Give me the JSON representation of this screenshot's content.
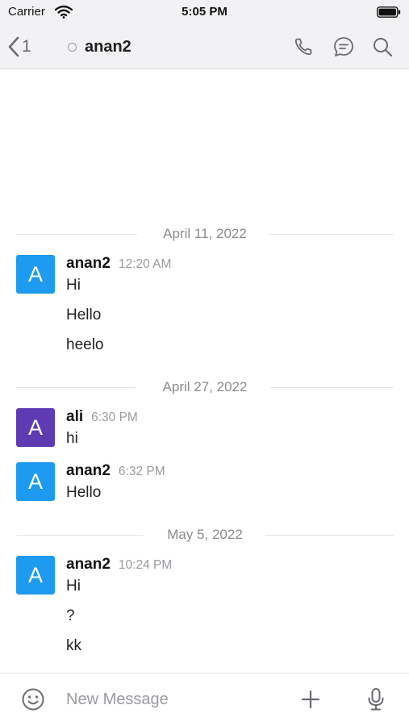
{
  "status_bar": {
    "carrier": "Carrier",
    "time": "5:05 PM"
  },
  "header": {
    "back_count": "1",
    "room_name": "anan2"
  },
  "icons": {
    "wifi": "wifi-icon",
    "battery": "battery-icon",
    "back": "chevron-left-icon",
    "presence": "status-offline-icon",
    "call": "phone-icon",
    "threads": "discussion-icon",
    "search": "search-icon",
    "emoji": "smiley-icon",
    "plus": "plus-icon",
    "mic": "microphone-icon"
  },
  "colors": {
    "avatar_anan2": "#1d9bf0",
    "avatar_ali": "#5f3bb3",
    "divider": "#e3e3e6",
    "muted_text": "#9a9aa0"
  },
  "days": [
    {
      "date": "April 11, 2022"
    },
    {
      "date": "April 27, 2022"
    },
    {
      "date": "May 5, 2022"
    }
  ],
  "messages": [
    {
      "avatar_letter": "A",
      "author": "anan2",
      "time": "12:20 AM",
      "lines": [
        "Hi",
        "Hello",
        "heelo"
      ]
    },
    {
      "avatar_letter": "A",
      "author": "ali",
      "time": "6:30 PM",
      "lines": [
        "hi"
      ]
    },
    {
      "avatar_letter": "A",
      "author": "anan2",
      "time": "6:32 PM",
      "lines": [
        "Hello"
      ]
    },
    {
      "avatar_letter": "A",
      "author": "anan2",
      "time": "10:24 PM",
      "lines": [
        "Hi",
        "?",
        "kk"
      ]
    }
  ],
  "composer": {
    "placeholder": "New Message"
  }
}
